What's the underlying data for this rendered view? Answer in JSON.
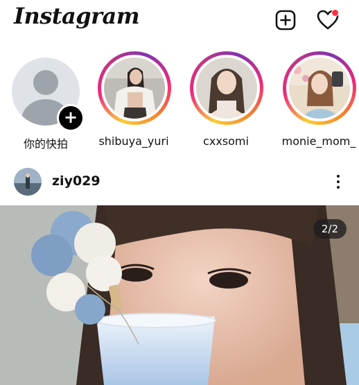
{
  "header": {
    "logo_text": "Instagram",
    "new_post_icon": "plus-square-icon",
    "activity_icon": "heart-icon",
    "notification_dot_color": "#ff3040"
  },
  "stories": {
    "own": {
      "label": "你的快拍",
      "add_icon": "plus-icon"
    },
    "items": [
      {
        "label": "shibuya_yuri"
      },
      {
        "label": "cxxsomi"
      },
      {
        "label": "monie_mom_"
      }
    ],
    "ring_colors": [
      "#f9ce34",
      "#ee2a7b",
      "#c13584",
      "#8134af",
      "#f58529"
    ]
  },
  "post": {
    "username": "ziy029",
    "more_icon": "more-vertical-icon",
    "page_indicator": "2/2"
  }
}
